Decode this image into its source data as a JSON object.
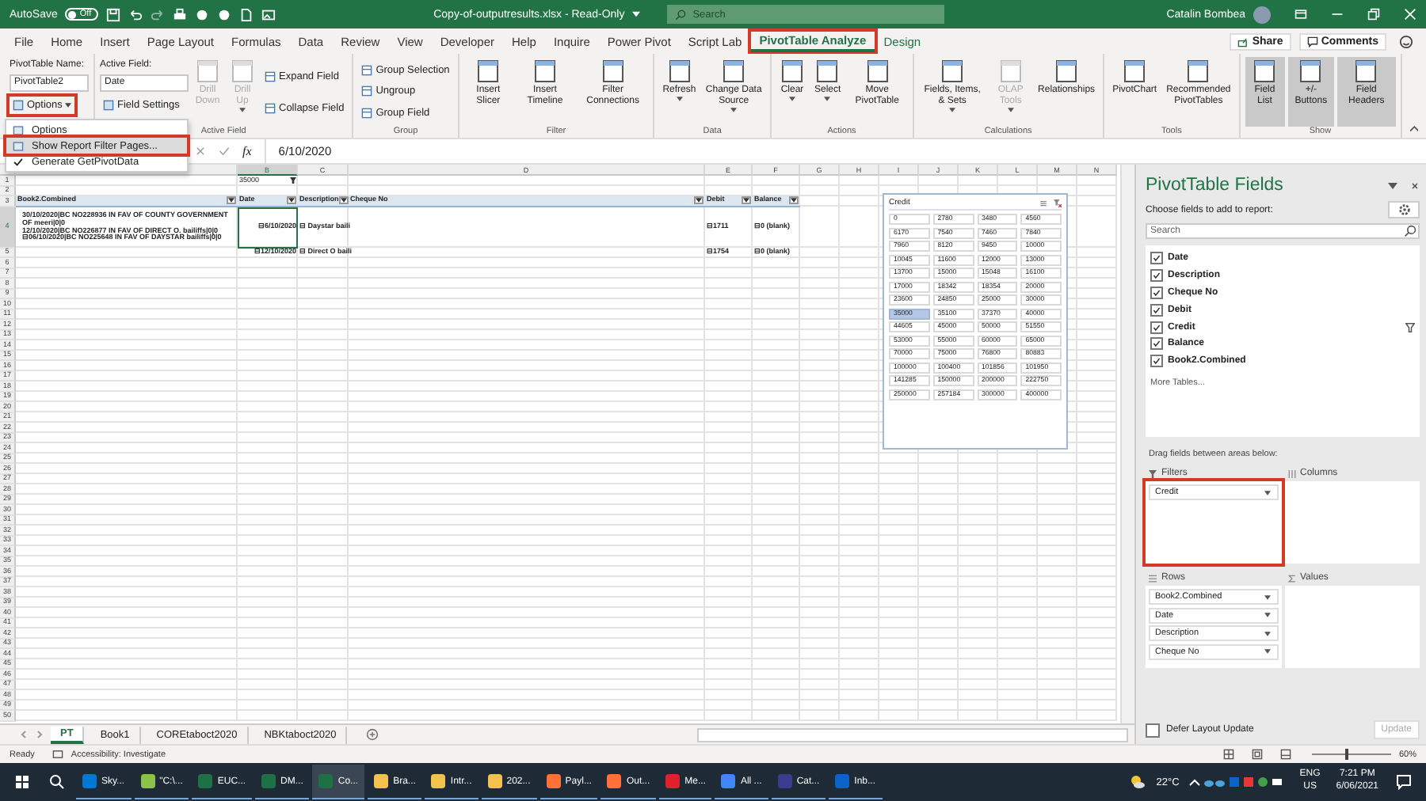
{
  "title_bar": {
    "autosave_label": "AutoSave",
    "autosave_toggle": {
      "label": "Off",
      "on": false
    },
    "file_title": "Copy-of-outputresults.xlsx - Read-Only",
    "search_placeholder": "Search",
    "user_name": "Catalin Bombea"
  },
  "menu_tabs": [
    {
      "label": "File",
      "kind": "standard",
      "selected": false,
      "annotated": false
    },
    {
      "label": "Home",
      "kind": "standard",
      "selected": false,
      "annotated": false
    },
    {
      "label": "Insert",
      "kind": "standard",
      "selected": false,
      "annotated": false
    },
    {
      "label": "Page Layout",
      "kind": "standard",
      "selected": false,
      "annotated": false
    },
    {
      "label": "Formulas",
      "kind": "standard",
      "selected": false,
      "annotated": false
    },
    {
      "label": "Data",
      "kind": "standard",
      "selected": false,
      "annotated": false
    },
    {
      "label": "Review",
      "kind": "standard",
      "selected": false,
      "annotated": false
    },
    {
      "label": "View",
      "kind": "standard",
      "selected": false,
      "annotated": false
    },
    {
      "label": "Developer",
      "kind": "standard",
      "selected": false,
      "annotated": false
    },
    {
      "label": "Help",
      "kind": "standard",
      "selected": false,
      "annotated": false
    },
    {
      "label": "Inquire",
      "kind": "standard",
      "selected": false,
      "annotated": false
    },
    {
      "label": "Power Pivot",
      "kind": "standard",
      "selected": false,
      "annotated": false
    },
    {
      "label": "Script Lab",
      "kind": "standard",
      "selected": false,
      "annotated": false
    },
    {
      "label": "PivotTable Analyze",
      "kind": "contextual",
      "selected": true,
      "annotated": true
    },
    {
      "label": "Design",
      "kind": "contextual",
      "selected": false,
      "annotated": false
    }
  ],
  "share_button": "Share",
  "comments_button": "Comments",
  "ribbon": {
    "pivot_name_label": "PivotTable Name:",
    "pivot_name": "PivotTable2",
    "options_button": {
      "label": "Options",
      "annotated": true
    },
    "groups": [
      {
        "caption": "Active Field",
        "field_label": "Active Field:",
        "field_value": "Date",
        "settings_button": "Field Settings",
        "buttons": [
          {
            "label": "Drill Down",
            "kind": "large",
            "disabled": true
          },
          {
            "label": "Drill Up",
            "kind": "large",
            "disabled": true,
            "dropdown": true
          },
          {
            "label": "Expand Field",
            "kind": "small",
            "disabled": false
          },
          {
            "label": "Collapse Field",
            "kind": "small",
            "disabled": false
          }
        ]
      },
      {
        "caption": "Group",
        "buttons": [
          {
            "label": "Group Selection",
            "kind": "small"
          },
          {
            "label": "Ungroup",
            "kind": "small"
          },
          {
            "label": "Group Field",
            "kind": "small"
          }
        ]
      },
      {
        "caption": "Filter",
        "buttons": [
          {
            "label": "Insert Slicer",
            "kind": "large"
          },
          {
            "label": "Insert Timeline",
            "kind": "large"
          },
          {
            "label": "Filter Connections",
            "kind": "large"
          }
        ]
      },
      {
        "caption": "Data",
        "buttons": [
          {
            "label": "Refresh",
            "kind": "large",
            "dropdown": true
          },
          {
            "label": "Change Data Source",
            "kind": "large",
            "dropdown": true
          }
        ]
      },
      {
        "caption": "Actions",
        "buttons": [
          {
            "label": "Clear",
            "kind": "large",
            "dropdown": true
          },
          {
            "label": "Select",
            "kind": "large",
            "dropdown": true
          },
          {
            "label": "Move PivotTable",
            "kind": "large"
          }
        ]
      },
      {
        "caption": "Calculations",
        "buttons": [
          {
            "label": "Fields, Items, & Sets",
            "kind": "large",
            "disabled": false,
            "dropdown": true
          },
          {
            "label": "OLAP Tools",
            "kind": "large",
            "disabled": true,
            "dropdown": true
          },
          {
            "label": "Relationships",
            "kind": "large",
            "disabled": false
          }
        ]
      },
      {
        "caption": "Tools",
        "buttons": [
          {
            "label": "PivotChart",
            "kind": "large"
          },
          {
            "label": "Recommended PivotTables",
            "kind": "large"
          }
        ]
      },
      {
        "caption": "Show",
        "buttons": [
          {
            "label": "Field List",
            "kind": "large",
            "pressed": true
          },
          {
            "label": "+/- Buttons",
            "kind": "large",
            "pressed": true
          },
          {
            "label": "Field Headers",
            "kind": "large",
            "pressed": true
          }
        ]
      }
    ]
  },
  "options_menu": {
    "items": [
      {
        "label": "Options",
        "checked": false,
        "highlighted": false,
        "annotated": false
      },
      {
        "label": "Show Report Filter Pages...",
        "checked": false,
        "highlighted": true,
        "annotated": true
      },
      {
        "label": "Generate GetPivotData",
        "checked": true,
        "highlighted": false,
        "annotated": false
      }
    ]
  },
  "formula_bar": {
    "function_label": "fx",
    "value": "6/10/2020"
  },
  "sheet": {
    "column_headers": [
      "B",
      "C",
      "D",
      "E",
      "F",
      "G",
      "H",
      "I",
      "J",
      "K",
      "L",
      "M",
      "N"
    ],
    "row_numbers": [
      "1",
      "2",
      "3",
      "4",
      "5",
      "6",
      "7",
      "8",
      "9",
      "10",
      "11",
      "12",
      "13",
      "14",
      "15",
      "16",
      "17",
      "18",
      "19",
      "20",
      "21",
      "22",
      "23",
      "24",
      "25",
      "26",
      "27",
      "28",
      "29",
      "30",
      "31",
      "32",
      "33",
      "34",
      "35",
      "36",
      "37",
      "38",
      "39",
      "40",
      "41",
      "42",
      "43",
      "44",
      "45",
      "46",
      "47",
      "48",
      "49",
      "50"
    ],
    "pivot": {
      "filter_value": "35000",
      "headers": [
        "Book2.Combined",
        "Date",
        "Description",
        "Cheque No",
        "Debit",
        "Balance"
      ],
      "rows": [
        {
          "combined": [
            "30/10/2020|BC NO228936 IN FAV OF COUNTY GOVERNMENT OF meeri|0|0",
            "12/10/2020|BC NO226877 IN FAV OF DIRECT O. bailiffs|0|0",
            "⊟06/10/2020|BC NO225648 IN FAV OF DAYSTAR bailiffs|0|0"
          ],
          "date": "⊟6/10/2020",
          "description": "⊟ Daystar baili",
          "debit": "⊟1711",
          "balance": "⊟0 (blank)",
          "selected": true
        },
        {
          "date": "⊟12/10/2020",
          "description": "⊟ Direct O baili",
          "debit": "⊟1754",
          "balance": "⊟0 (blank)",
          "selected": false
        }
      ]
    },
    "slicer": {
      "title": "Credit",
      "items": [
        {
          "label": "0",
          "selected": false
        },
        {
          "label": "2780",
          "selected": false
        },
        {
          "label": "3480",
          "selected": false
        },
        {
          "label": "4560",
          "selected": false
        },
        {
          "label": "6170",
          "selected": false
        },
        {
          "label": "7540",
          "selected": false
        },
        {
          "label": "7460",
          "selected": false
        },
        {
          "label": "7840",
          "selected": false
        },
        {
          "label": "7960",
          "selected": false
        },
        {
          "label": "8120",
          "selected": false
        },
        {
          "label": "9450",
          "selected": false
        },
        {
          "label": "10000",
          "selected": false
        },
        {
          "label": "10045",
          "selected": false
        },
        {
          "label": "11600",
          "selected": false
        },
        {
          "label": "12000",
          "selected": false
        },
        {
          "label": "13000",
          "selected": false
        },
        {
          "label": "13700",
          "selected": false
        },
        {
          "label": "15000",
          "selected": false
        },
        {
          "label": "15048",
          "selected": false
        },
        {
          "label": "16100",
          "selected": false
        },
        {
          "label": "17000",
          "selected": false
        },
        {
          "label": "18342",
          "selected": false
        },
        {
          "label": "18354",
          "selected": false
        },
        {
          "label": "20000",
          "selected": false
        },
        {
          "label": "23600",
          "selected": false
        },
        {
          "label": "24850",
          "selected": false
        },
        {
          "label": "25000",
          "selected": false
        },
        {
          "label": "30000",
          "selected": false
        },
        {
          "label": "35000",
          "selected": true
        },
        {
          "label": "35100",
          "selected": false
        },
        {
          "label": "37370",
          "selected": false
        },
        {
          "label": "40000",
          "selected": false
        },
        {
          "label": "44605",
          "selected": false
        },
        {
          "label": "45000",
          "selected": false
        },
        {
          "label": "50000",
          "selected": false
        },
        {
          "label": "51550",
          "selected": false
        },
        {
          "label": "53000",
          "selected": false
        },
        {
          "label": "55000",
          "selected": false
        },
        {
          "label": "60000",
          "selected": false
        },
        {
          "label": "65000",
          "selected": false
        },
        {
          "label": "70000",
          "selected": false
        },
        {
          "label": "75000",
          "selected": false
        },
        {
          "label": "76800",
          "selected": false
        },
        {
          "label": "80883",
          "selected": false
        },
        {
          "label": "100000",
          "selected": false
        },
        {
          "label": "100400",
          "selected": false
        },
        {
          "label": "101856",
          "selected": false
        },
        {
          "label": "101950",
          "selected": false
        },
        {
          "label": "141285",
          "selected": false
        },
        {
          "label": "150000",
          "selected": false
        },
        {
          "label": "200000",
          "selected": false
        },
        {
          "label": "222750",
          "selected": false
        },
        {
          "label": "250000",
          "selected": false
        },
        {
          "label": "257184",
          "selected": false
        },
        {
          "label": "300000",
          "selected": false
        },
        {
          "label": "400000",
          "selected": false
        }
      ]
    },
    "tabs": [
      {
        "label": "PT",
        "selected": true
      },
      {
        "label": "Book1",
        "selected": false
      },
      {
        "label": "COREtaboct2020",
        "selected": false
      },
      {
        "label": "NBKtaboct2020",
        "selected": false
      }
    ]
  },
  "pane": {
    "title": "PivotTable Fields",
    "subtitle": "Choose fields to add to report:",
    "search_placeholder": "Search",
    "fields": [
      {
        "label": "Date",
        "checked": true,
        "filtered": false
      },
      {
        "label": "Description",
        "checked": true,
        "filtered": false
      },
      {
        "label": "Cheque No",
        "checked": true,
        "filtered": false
      },
      {
        "label": "Debit",
        "checked": true,
        "filtered": false
      },
      {
        "label": "Credit",
        "checked": true,
        "filtered": true
      },
      {
        "label": "Balance",
        "checked": true,
        "filtered": false
      },
      {
        "label": "Book2.Combined",
        "checked": true,
        "filtered": false
      }
    ],
    "more_tables": "More Tables...",
    "drag_hint": "Drag fields between areas below:",
    "areas": [
      {
        "kind": "filters",
        "title": "Filters",
        "items": [
          "Credit"
        ],
        "annotated": true
      },
      {
        "kind": "columns",
        "title": "Columns",
        "annotated": false
      },
      {
        "kind": "rows",
        "title": "Rows",
        "items": [
          "Book2.Combined",
          "Date",
          "Description",
          "Cheque No"
        ],
        "annotated": false
      },
      {
        "kind": "values",
        "title": "Values",
        "annotated": false
      }
    ],
    "defer": {
      "label": "Defer Layout Update",
      "checked": false
    },
    "update_button": {
      "label": "Update",
      "disabled": true
    }
  },
  "status_bar": {
    "ready": "Ready",
    "accessibility": "Accessibility: Investigate",
    "zoom_label": "60%",
    "zoom_slider": {
      "level": 0.42
    }
  },
  "taskbar": {
    "apps": [
      {
        "label": "Sky...",
        "color": "#0078d4",
        "selected": false
      },
      {
        "label": "\"C:\\...",
        "color": "#8bc34a",
        "selected": false
      },
      {
        "label": "EUC...",
        "color": "#1e7145",
        "selected": false
      },
      {
        "label": "DM...",
        "color": "#1e7145",
        "selected": false
      },
      {
        "label": "Co...",
        "color": "#1e7145",
        "selected": true
      },
      {
        "label": "Bra...",
        "color": "#f2c14e",
        "selected": false
      },
      {
        "label": "Intr...",
        "color": "#f2c14e",
        "selected": false
      },
      {
        "label": "202...",
        "color": "#f2c14e",
        "selected": false
      },
      {
        "label": "Payl...",
        "color": "#ff7139",
        "selected": false
      },
      {
        "label": "Out...",
        "color": "#ff7139",
        "selected": false
      },
      {
        "label": "Me...",
        "color": "#e0202b",
        "selected": false
      },
      {
        "label": "All ...",
        "color": "#4285f4",
        "selected": false
      },
      {
        "label": "Cat...",
        "color": "#3b3b8f",
        "selected": false
      },
      {
        "label": "Inb...",
        "color": "#0a64c8",
        "selected": false
      }
    ],
    "weather": "22°C",
    "lang_top": "ENG",
    "lang_bottom": "US",
    "time": "7:21 PM",
    "date": "6/06/2021"
  }
}
